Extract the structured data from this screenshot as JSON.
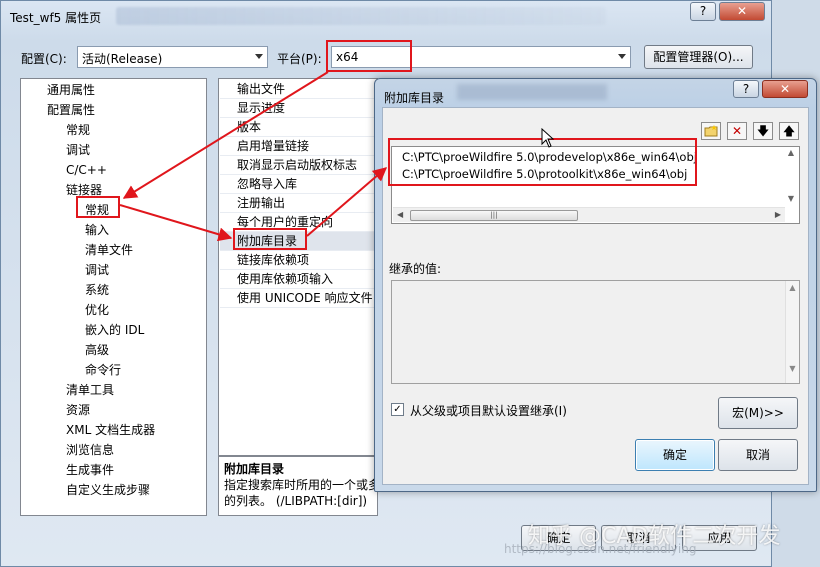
{
  "window": {
    "title": "Test_wf5 属性页",
    "help": "?",
    "close": "✕"
  },
  "config": {
    "label": "配置(C):",
    "value": "活动(Release)",
    "platform_label": "平台(P):",
    "platform_value": "x64",
    "manager_button": "配置管理器(O)..."
  },
  "tree": [
    "通用属性",
    "配置属性",
    "常规",
    "调试",
    "C/C++",
    "链接器",
    "常规",
    "输入",
    "清单文件",
    "调试",
    "系统",
    "优化",
    "嵌入的 IDL",
    "高级",
    "命令行",
    "清单工具",
    "资源",
    "XML 文档生成器",
    "浏览信息",
    "生成事件",
    "自定义生成步骤"
  ],
  "grid": [
    "输出文件",
    "显示进度",
    "版本",
    "启用增量链接",
    "取消显示启动版权标志",
    "忽略导入库",
    "注册输出",
    "每个用户的重定向",
    "附加库目录",
    "链接库依赖项",
    "使用库依赖项输入",
    "使用 UNICODE 响应文件"
  ],
  "description": {
    "title": "附加库目录",
    "line1": "指定搜索库时所用的一个或多",
    "line2": "的列表。   (/LIBPATH:[dir])"
  },
  "main_buttons": {
    "ok": "确定",
    "cancel": "取消",
    "apply": "应用"
  },
  "dialog": {
    "title": "附加库目录",
    "help": "?",
    "close": "✕",
    "dirs": [
      "C:\\PTC\\proeWildfire 5.0\\prodevelop\\x86e_win64\\obj",
      "C:\\PTC\\proeWildfire 5.0\\protoolkit\\x86e_win64\\obj"
    ],
    "inherited_label": "继承的值:",
    "inherit_checkbox": "从父级或项目默认设置继承(I)",
    "inherit_checked": "✓",
    "macro_button": "宏(M)>>",
    "ok": "确定",
    "cancel": "取消"
  },
  "watermark": {
    "text": "知乎 @CAD软件二次开发",
    "url": "https://blog.csdn.net/friendlying"
  },
  "colors": {
    "annotation": "#e0161c",
    "window_frame": "#6f8aa7"
  }
}
